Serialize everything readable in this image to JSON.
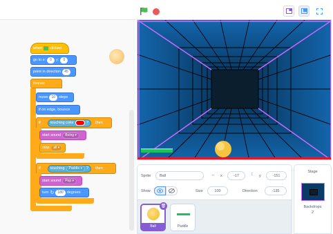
{
  "toolbar": {
    "green_flag": "green-flag-icon",
    "stop": "stop-icon"
  },
  "colors": {
    "motion": "#4c97ff",
    "events": "#ffbf00",
    "control": "#ffab19",
    "sound": "#cf63cf",
    "sensing": "#5cb1d6",
    "paddle": "#19c35b",
    "selected": "#855cd6"
  },
  "script": {
    "when_flag": "when",
    "clicked": "clicked",
    "goto_label": "go to x:",
    "goto_x": "0",
    "goto_y_label": "y:",
    "goto_y": "0",
    "point_label": "point in direction",
    "point_value": "45",
    "forever": "forever",
    "move_label": "move",
    "move_value": "10",
    "steps": "steps",
    "bounce": "if on edge, bounce",
    "if1": "if",
    "touching_color": "touching color",
    "q1": "?",
    "then1": "then",
    "start_sound1": "start sound",
    "sound1": "Boing",
    "stop_label": "stop",
    "stop_value": "all",
    "if2": "if",
    "touching": "touching",
    "touching_target": "Paddle",
    "q2": "?",
    "then2": "then",
    "start_sound2": "start sound",
    "sound2": "Pop",
    "turn_label": "turn",
    "turn_value": "180",
    "degrees": "degrees"
  },
  "sprite_info": {
    "sprite_label": "Sprite",
    "sprite_name": "Ball",
    "x_label": "x",
    "x_value": "-17",
    "y_label": "y",
    "y_value": "-151",
    "show_label": "Show",
    "size_label": "Size",
    "size_value": "100",
    "direction_label": "Direction",
    "direction_value": "-135"
  },
  "sprites": [
    {
      "name": "Ball"
    },
    {
      "name": "Paddle"
    }
  ],
  "stage_panel": {
    "title": "Stage",
    "backdrops_label": "Backdrops",
    "backdrops_count": "2"
  }
}
